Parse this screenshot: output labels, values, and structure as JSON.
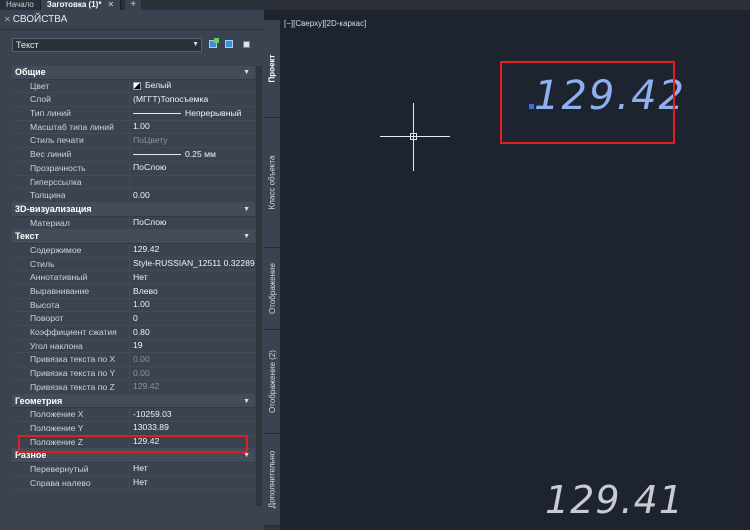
{
  "tabs": [
    {
      "label": "Начало",
      "active": false
    },
    {
      "label": "Заготовка (1)*",
      "active": true,
      "close": "✕"
    }
  ],
  "tab_add": "+",
  "panel": {
    "title": "СВОЙСТВА",
    "selector_value": "Текст",
    "sections": [
      {
        "name": "Общие",
        "rows": [
          {
            "label": "Цвет",
            "value": "Белый",
            "swatch": true
          },
          {
            "label": "Слой",
            "value": "(МГГТ)Топосъемка"
          },
          {
            "label": "Тип линий",
            "value": "Непрерывный",
            "line": true
          },
          {
            "label": "Масштаб типа линий",
            "value": "1.00"
          },
          {
            "label": "Стиль печати",
            "value": "ПоЦвету",
            "dim": true
          },
          {
            "label": "Вес линий",
            "value": "0.25 мм",
            "line": true
          },
          {
            "label": "Прозрачность",
            "value": "ПоСлою"
          },
          {
            "label": "Гиперссылка",
            "value": ""
          },
          {
            "label": "Толщина",
            "value": "0.00"
          }
        ]
      },
      {
        "name": "3D-визуализация",
        "rows": [
          {
            "label": "Материал",
            "value": "ПоСлою"
          }
        ]
      },
      {
        "name": "Текст",
        "rows": [
          {
            "label": "Содержимое",
            "value": "129.42"
          },
          {
            "label": "Стиль",
            "value": "Style-RUSSIAN_12511 0.32289"
          },
          {
            "label": "Аннотативный",
            "value": "Нет"
          },
          {
            "label": "Выравнивание",
            "value": "Влево"
          },
          {
            "label": "Высота",
            "value": "1.00"
          },
          {
            "label": "Поворот",
            "value": "0"
          },
          {
            "label": "Коэффициент сжатия",
            "value": "0.80"
          },
          {
            "label": "Угол наклона",
            "value": "19"
          },
          {
            "label": "Привязка текста по X",
            "value": "0.00",
            "dim": true
          },
          {
            "label": "Привязка текста по Y",
            "value": "0.00",
            "dim": true
          },
          {
            "label": "Привязка текста по Z",
            "value": "129.42",
            "dim": true
          }
        ]
      },
      {
        "name": "Геометрия",
        "rows": [
          {
            "label": "Положение X",
            "value": "-10259.03"
          },
          {
            "label": "Положение Y",
            "value": "13033.89"
          },
          {
            "label": "Положение Z",
            "value": "129.42"
          }
        ]
      },
      {
        "name": "Разное",
        "rows": [
          {
            "label": "Перевернутый",
            "value": "Нет"
          },
          {
            "label": "Справа налево",
            "value": "Нет"
          }
        ]
      }
    ]
  },
  "side_tabs": [
    {
      "label": "Проект",
      "active": true
    },
    {
      "label": "Класс объекта",
      "active": false
    },
    {
      "label": "Отображение",
      "active": false
    },
    {
      "label": "Отображение (2)",
      "active": false
    },
    {
      "label": "Дополнительно",
      "active": false
    }
  ],
  "viewport_label": "[−][Сверху][2D-каркас]",
  "drawing": {
    "text_selected": "129.42",
    "text_other": "129.41"
  },
  "colors": {
    "panel_bg": "#3b4250",
    "canvas_bg": "#1d2430",
    "annotation_red": "#e0201f",
    "selected_text": "#8fb0ee"
  }
}
